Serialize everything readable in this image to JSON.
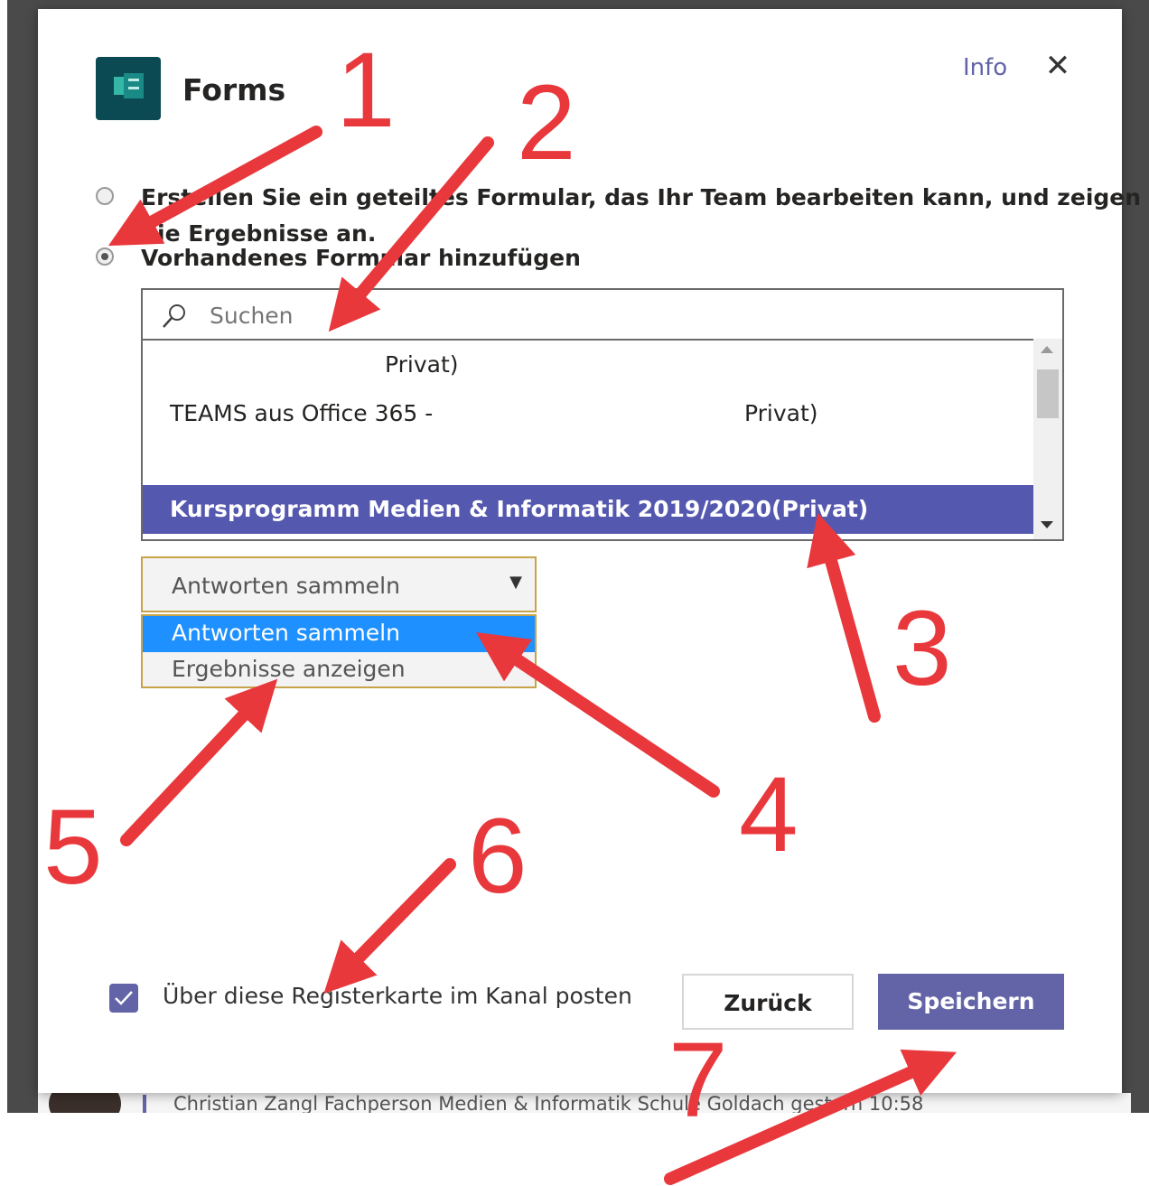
{
  "background": {
    "message_preview": "Christian Zangl Fachperson Medien & Informatik Schule Goldach  gestern 10:58"
  },
  "dialog": {
    "app_name": "Forms",
    "info_label": "Info",
    "close_icon": "close-icon",
    "options": [
      {
        "label": "Erstellen Sie ein geteiltes Formular, das Ihr Team bearbeiten kann, und zeigen",
        "label_line2": "Sie Ergebnisse an.",
        "selected": false
      },
      {
        "label": "Vorhandenes Formular hinzufügen",
        "selected": true
      }
    ],
    "search": {
      "placeholder": "Suchen",
      "icon": "search-icon"
    },
    "forms_list": [
      {
        "label": "Privat)",
        "selected": false
      },
      {
        "label": "TEAMS aus Office 365 -",
        "label_suffix": "Privat)",
        "selected": false
      },
      {
        "label": "",
        "selected": false
      },
      {
        "label": "Kursprogramm Medien & Informatik 2019/2020(Privat)",
        "selected": true
      }
    ],
    "mode_select": {
      "value": "Antworten sammeln",
      "options": [
        "Antworten sammeln",
        "Ergebnisse anzeigen"
      ],
      "highlighted": "Antworten sammeln"
    },
    "post_checkbox": {
      "label": "Über diese Registerkarte im Kanal posten",
      "checked": true
    },
    "buttons": {
      "back": "Zurück",
      "save": "Speichern"
    }
  },
  "annotations": {
    "color": "#e8383c",
    "numbers": [
      "1",
      "2",
      "3",
      "4",
      "5",
      "6",
      "7"
    ]
  }
}
